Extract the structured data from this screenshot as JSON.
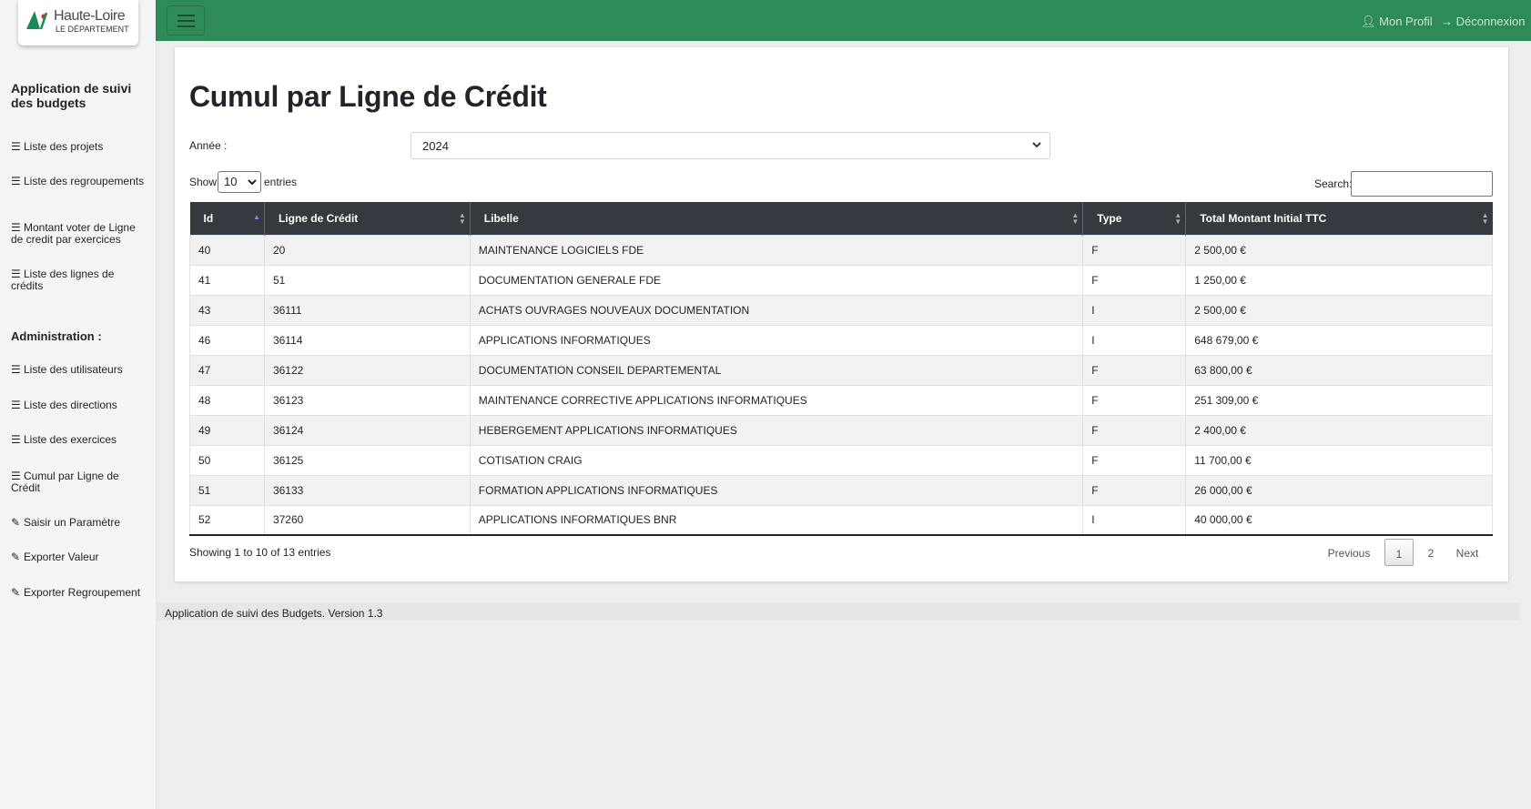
{
  "logo": {
    "line1": "Haute-Loire",
    "line2": "LE DÉPARTEMENT"
  },
  "sidebar": {
    "title": "Application de suivi des budgets",
    "items": [
      {
        "label": "Liste des projets",
        "icon": "list-icon"
      },
      {
        "label": "Liste des regroupements",
        "icon": "list-icon"
      },
      {
        "label": "Montant voter de Ligne de credit par exercices",
        "icon": "list-icon"
      },
      {
        "label": "Liste des lignes de crédits",
        "icon": "list-icon"
      }
    ],
    "admin_heading": "Administration :",
    "admin_items": [
      {
        "label": "Liste des utilisateurs",
        "icon": "list-icon"
      },
      {
        "label": "Liste des directions",
        "icon": "list-icon"
      },
      {
        "label": "Liste des exercices",
        "icon": "list-icon"
      },
      {
        "label": "Cumul par Ligne de Crédit",
        "icon": "list-icon"
      },
      {
        "label": "Saisir un Paramètre",
        "icon": "pencil-icon"
      },
      {
        "label": "Exporter Valeur",
        "icon": "pencil-icon"
      },
      {
        "label": "Exporter Regroupement",
        "icon": "pencil-icon"
      }
    ]
  },
  "topbar": {
    "profile_label": "Mon Profil",
    "logout_label": "Déconnexion"
  },
  "main": {
    "title": "Cumul par Ligne de Crédit",
    "year_label": "Année :",
    "year_value": "2024",
    "show_label": "Show",
    "show_value": "10",
    "entries_label": "entries",
    "search_label": "Search:",
    "table": {
      "headers": [
        "Id",
        "Ligne de Crédit",
        "Libelle",
        "Type",
        "Total Montant Initial TTC"
      ],
      "rows": [
        [
          "40",
          "20",
          "MAINTENANCE LOGICIELS FDE",
          "F",
          "2 500,00 €"
        ],
        [
          "41",
          "51",
          "DOCUMENTATION GENERALE FDE",
          "F",
          "1 250,00 €"
        ],
        [
          "43",
          "36111",
          "ACHATS OUVRAGES NOUVEAUX DOCUMENTATION",
          "I",
          "2 500,00 €"
        ],
        [
          "46",
          "36114",
          "APPLICATIONS INFORMATIQUES",
          "I",
          "648 679,00 €"
        ],
        [
          "47",
          "36122",
          "DOCUMENTATION CONSEIL DEPARTEMENTAL",
          "F",
          "63 800,00 €"
        ],
        [
          "48",
          "36123",
          "MAINTENANCE CORRECTIVE APPLICATIONS INFORMATIQUES",
          "F",
          "251 309,00 €"
        ],
        [
          "49",
          "36124",
          "HEBERGEMENT APPLICATIONS INFORMATIQUES",
          "F",
          "2 400,00 €"
        ],
        [
          "50",
          "36125",
          "COTISATION CRAIG",
          "F",
          "11 700,00 €"
        ],
        [
          "51",
          "36133",
          "FORMATION APPLICATIONS INFORMATIQUES",
          "F",
          "26 000,00 €"
        ],
        [
          "52",
          "37260",
          "APPLICATIONS INFORMATIQUES BNR",
          "I",
          "40 000,00 €"
        ]
      ]
    },
    "info": "Showing 1 to 10 of 13 entries",
    "pagination": {
      "previous": "Previous",
      "pages": [
        "1",
        "2"
      ],
      "next": "Next"
    }
  },
  "footer": "Application de suivi des Budgets. Version 1.3",
  "colors": {
    "topbar": "#2e8b57",
    "table_header": "#343a40",
    "logo_green": "#1b8a5a"
  }
}
